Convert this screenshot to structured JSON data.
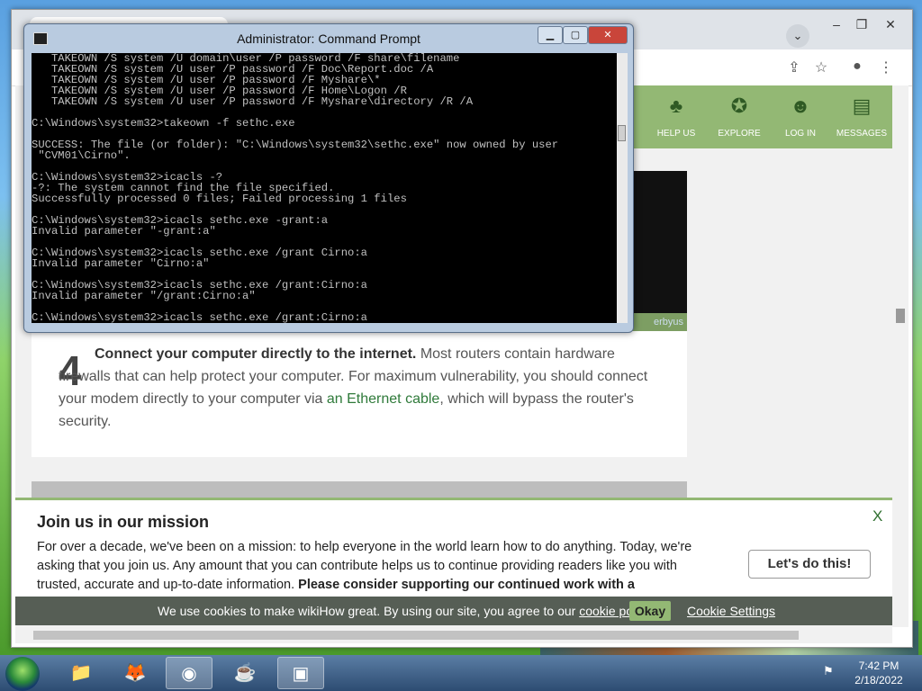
{
  "cmd": {
    "title": "Administrator: Command Prompt",
    "console_lines": [
      "   TAKEOWN /S system /U domain\\user /P password /F share\\filename",
      "   TAKEOWN /S system /U user /P password /F Doc\\Report.doc /A",
      "   TAKEOWN /S system /U user /P password /F Myshare\\*",
      "   TAKEOWN /S system /U user /P password /F Home\\Logon /R",
      "   TAKEOWN /S system /U user /P password /F Myshare\\directory /R /A",
      "",
      "C:\\Windows\\system32>takeown -f sethc.exe",
      "",
      "SUCCESS: The file (or folder): \"C:\\Windows\\system32\\sethc.exe\" now owned by user",
      " \"CVM01\\Cirno\".",
      "",
      "C:\\Windows\\system32>icacls -?",
      "-?: The system cannot find the file specified.",
      "Successfully processed 0 files; Failed processing 1 files",
      "",
      "C:\\Windows\\system32>icacls sethc.exe -grant:a",
      "Invalid parameter \"-grant:a\"",
      "",
      "C:\\Windows\\system32>icacls sethc.exe /grant Cirno:a",
      "Invalid parameter \"Cirno:a\"",
      "",
      "C:\\Windows\\system32>icacls sethc.exe /grant:Cirno:a",
      "Invalid parameter \"/grant:Cirno:a\"",
      "",
      "C:\\Windows\\system32>icacls sethc.exe /grant:Cirno:a"
    ]
  },
  "nav": [
    {
      "label": "HELP US",
      "icon": "sprout-icon"
    },
    {
      "label": "EXPLORE",
      "icon": "compass-icon"
    },
    {
      "label": "LOG IN",
      "icon": "user-icon"
    },
    {
      "label": "MESSAGES",
      "icon": "chat-icon"
    }
  ],
  "step": {
    "number": "4",
    "title": "Connect your computer directly to the internet.",
    "body_before": " Most routers contain hardware firewalls that can help protect your computer. For maximum vulnerability, you should connect your modem directly to your computer via ",
    "link": "an Ethernet cable",
    "body_after": ", which will bypass the router's security."
  },
  "video": {
    "caption": "erbyus"
  },
  "banner": {
    "title": "Join us in our mission",
    "text": "For over a decade, we've been on a mission: to help everyone in the world learn how to do anything. Today, we're asking that you join us. Any amount that you can contribute helps us to continue providing readers like you with trusted, accurate and up-to-date information. ",
    "text_bold": "Please consider supporting our continued work with a",
    "cta": "Let's do this!",
    "close": "X"
  },
  "cookie": {
    "text": "We use cookies to make wikiHow great. By using our site, you agree to our ",
    "link": "cookie policy",
    "period": ".",
    "okay": "Okay",
    "settings": "Cookie Settings"
  },
  "taskbar": {
    "time": "7:42 PM",
    "date": "2/18/2022"
  },
  "colors": {
    "wikihow_green": "#93b874",
    "cmd_bg": "#000000",
    "cmd_text": "#c0c0c0",
    "cookie_bar": "#565e55"
  }
}
